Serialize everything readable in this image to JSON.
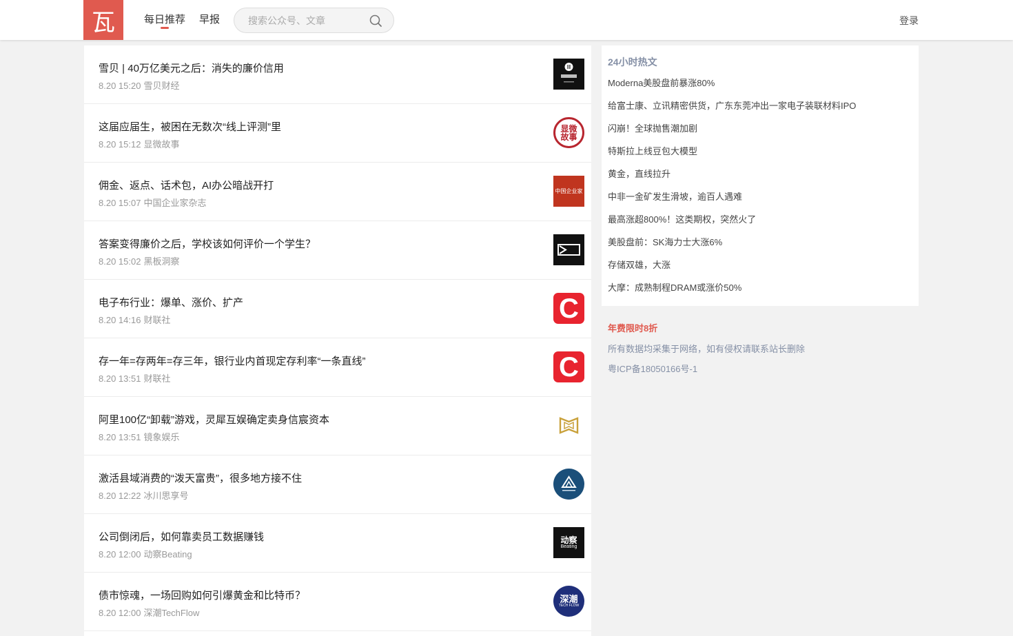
{
  "header": {
    "logo_glyph": "瓦",
    "nav": [
      {
        "label": "每日推荐",
        "active": true
      },
      {
        "label": "早报",
        "active": false
      }
    ],
    "search_placeholder": "搜索公众号、文章",
    "login_label": "登录"
  },
  "colors": {
    "brand": "#e05a4f",
    "muted_text": "#8590a6"
  },
  "articles": [
    {
      "title": "雪贝 | 40万亿美元之后：消失的廉价信用",
      "time": "8.20 15:20",
      "source": "雪贝财经",
      "thumb": "xuebei-logo"
    },
    {
      "title": "这届应届生，被困在无数次“线上评测”里",
      "time": "8.20 15:12",
      "source": "显微故事",
      "thumb": "xianwei-logo",
      "thumb_text": [
        "显微",
        "故事"
      ]
    },
    {
      "title": "佣金、返点、话术包，AI办公暗战开打",
      "time": "8.20 15:07",
      "source": "中国企业家杂志",
      "thumb": "zgqyj-logo",
      "thumb_text": "中国企业家"
    },
    {
      "title": "答案变得廉价之后，学校该如何评价一个学生？",
      "time": "8.20 15:02",
      "source": "黑板洞察",
      "thumb": "heiban-logo"
    },
    {
      "title": "电子布行业：爆单、涨价、扩产",
      "time": "8.20 14:16",
      "source": "财联社",
      "thumb": "cailianshe-logo",
      "thumb_text": "C"
    },
    {
      "title": "存一年=存两年=存三年，银行业内首现定存利率“一条直线”",
      "time": "8.20 13:51",
      "source": "财联社",
      "thumb": "cailianshe-logo",
      "thumb_text": "C"
    },
    {
      "title": "阿里100亿“卸载”游戏，灵犀互娱确定卖身信宸资本",
      "time": "8.20 13:51",
      "source": "镜象娱乐",
      "thumb": "jingxiang-logo"
    },
    {
      "title": "激活县域消费的“泼天富贵”，很多地方接不住",
      "time": "8.20 12:22",
      "source": "冰川思享号",
      "thumb": "bingchuan-logo"
    },
    {
      "title": "公司倒闭后，如何靠卖员工数据赚钱",
      "time": "8.20 12:00",
      "source": "动察Beating",
      "thumb": "dongcha-logo",
      "thumb_text": [
        "动察",
        "Beating"
      ]
    },
    {
      "title": "债市惊魂，一场回购如何引爆黄金和比特币？",
      "time": "8.20 12:00",
      "source": "深潮TechFlow",
      "thumb": "shenchao-logo",
      "thumb_text": [
        "深潮",
        "TECH FLOW"
      ]
    }
  ],
  "sidebar": {
    "heading": "24小时热文",
    "hot": [
      "Moderna美股盘前暴涨80%",
      "给富士康、立讯精密供货，广东东莞冲出一家电子装联材料IPO",
      "闪崩！全球抛售潮加剧",
      "特斯拉上线豆包大模型",
      "黄金，直线拉升",
      "中非一金矿发生滑坡，逾百人遇难",
      "最高涨超800%！这类期权，突然火了",
      "美股盘前：SK海力士大涨6%",
      "存储双雄，大涨",
      "大摩：成熟制程DRAM或涨价50%"
    ],
    "promo": "年费限时8折",
    "disclaimer": "所有数据均采集于网络，如有侵权请联系站长删除",
    "icp": "粤ICP备18050166号-1"
  }
}
